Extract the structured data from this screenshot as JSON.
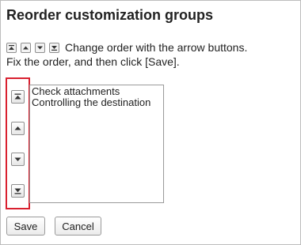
{
  "page": {
    "title": "Reorder customization groups",
    "instruction_line1": "Change order with the arrow buttons.",
    "instruction_line2": "Fix the order, and then click [Save]."
  },
  "order_buttons": [
    {
      "icon": "move-to-top-icon"
    },
    {
      "icon": "move-up-icon"
    },
    {
      "icon": "move-down-icon"
    },
    {
      "icon": "move-to-bottom-icon"
    }
  ],
  "list": {
    "items": [
      "Check attachments",
      "Controlling the destination"
    ]
  },
  "actions": {
    "save_label": "Save",
    "cancel_label": "Cancel"
  },
  "colors": {
    "highlight_border": "#d9202f",
    "text": "#222222"
  }
}
